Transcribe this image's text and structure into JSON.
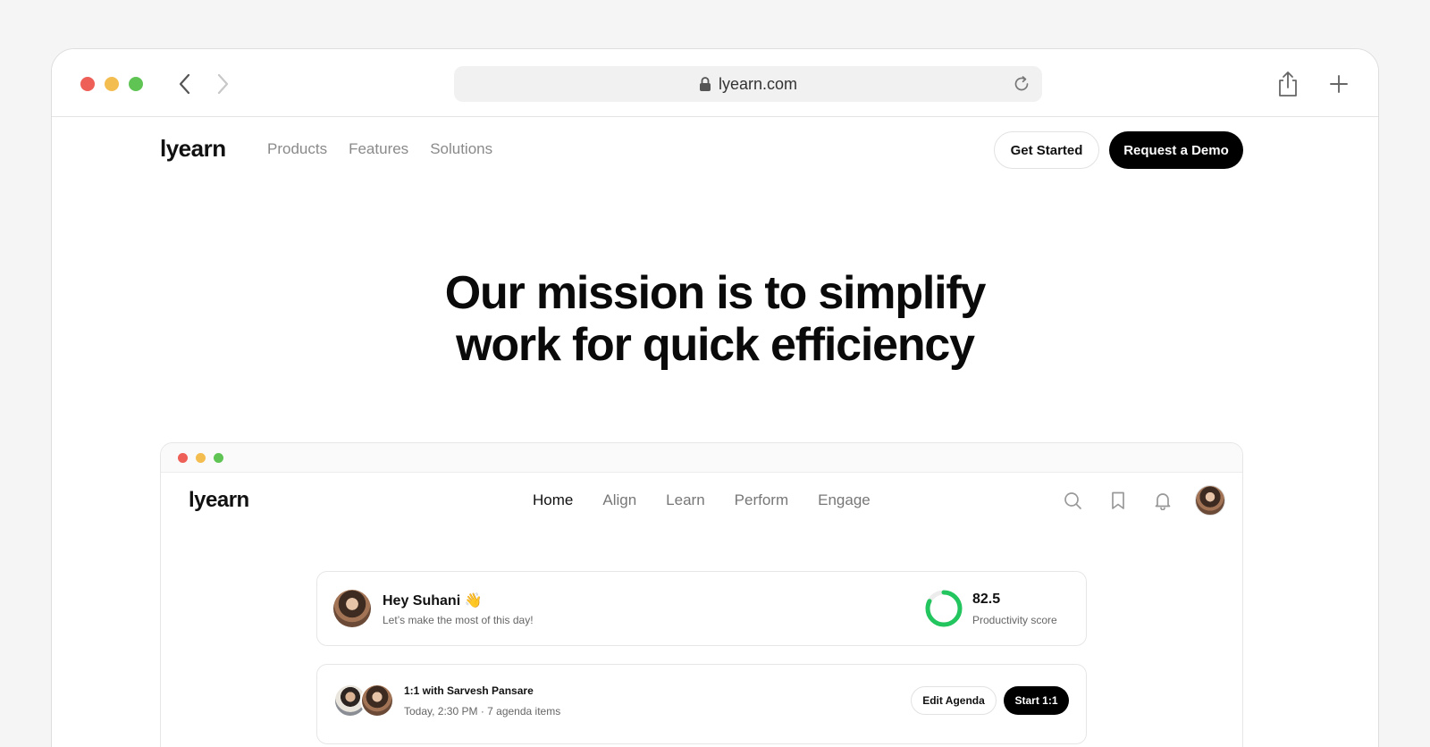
{
  "browser": {
    "url": "lyearn.com"
  },
  "site": {
    "logo": "lyearn",
    "nav": [
      "Products",
      "Features",
      "Solutions"
    ],
    "get_started": "Get Started",
    "request_demo": "Request a Demo"
  },
  "hero": {
    "line1": "Our mission is to simplify",
    "line2": "work for quick efficiency"
  },
  "app": {
    "logo": "lyearn",
    "nav": [
      "Home",
      "Align",
      "Learn",
      "Perform",
      "Engage"
    ],
    "active_nav": "Home",
    "greeting": {
      "title": "Hey Suhani 👋",
      "subtitle": "Let’s make the most of this day!"
    },
    "productivity": {
      "score": "82.5",
      "label": "Productivity score",
      "fraction": 0.825,
      "color": "#22c55e"
    },
    "meeting": {
      "title": "1:1 with Sarvesh Pansare",
      "subtitle": "Today, 2:30 PM · 7 agenda items",
      "edit_label": "Edit Agenda",
      "start_label": "Start 1:1"
    }
  },
  "icons": {
    "browser": [
      "back-icon",
      "forward-icon",
      "lock-icon",
      "reload-icon",
      "share-icon",
      "plus-icon"
    ],
    "app": [
      "search-icon",
      "bookmark-icon",
      "bell-icon"
    ]
  }
}
